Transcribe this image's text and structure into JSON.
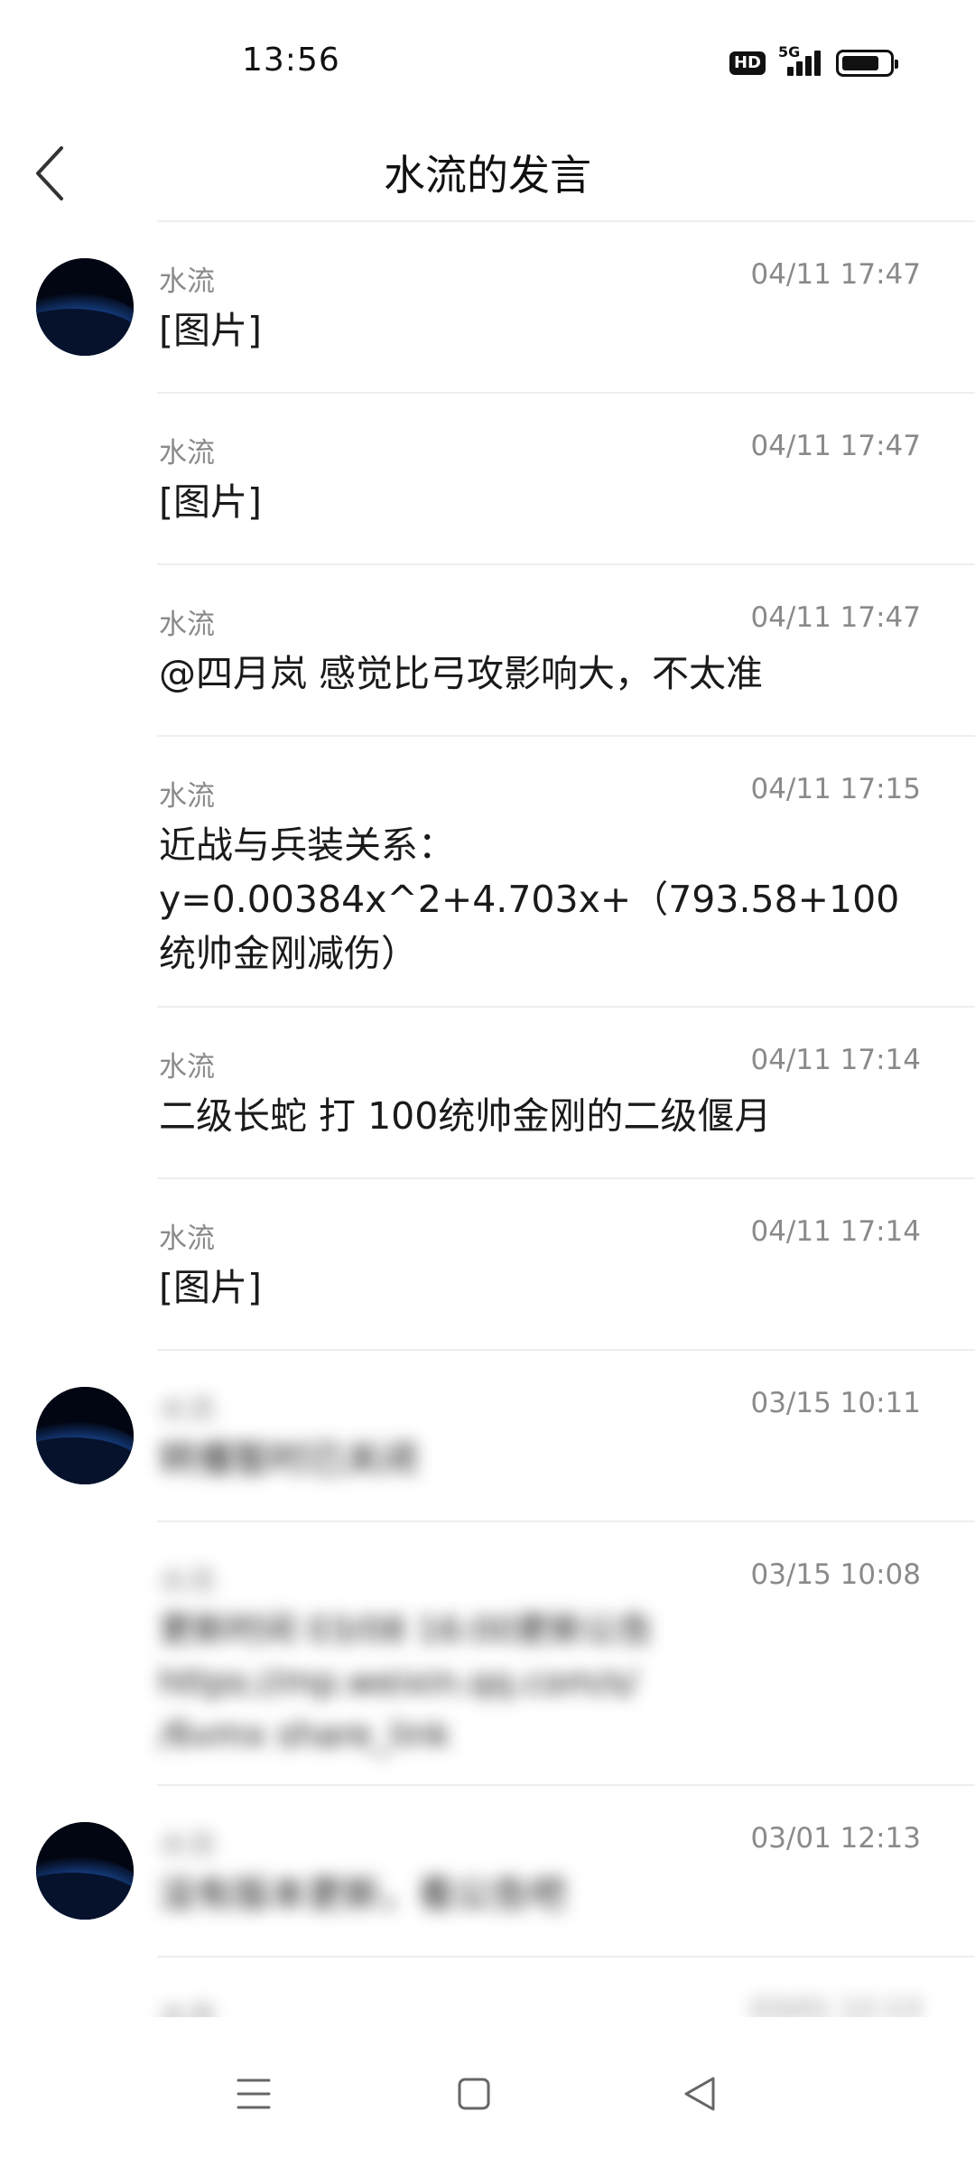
{
  "status_bar": {
    "time": "13:56",
    "hd_label": "HD",
    "network_label": "5G",
    "battery_level": 0.8
  },
  "header": {
    "title": "水流的发言",
    "back_icon": "chevron-left-icon"
  },
  "posts": [
    {
      "author": "水流",
      "time": "04/11 17:47",
      "content": "[图片]"
    },
    {
      "author": "水流",
      "time": "04/11 17:47",
      "content": "[图片]"
    },
    {
      "author": "水流",
      "time": "04/11 17:47",
      "content": "@四月岚 感觉比弓攻影响大，不太准"
    },
    {
      "author": "水流",
      "time": "04/11 17:15",
      "content": "近战与兵装关系：\ny=0.00384x^2+4.703x+（793.58+100统帅金刚减伤）"
    },
    {
      "author": "水流",
      "time": "04/11 17:14",
      "content": "二级长蛇 打 100统帅金刚的二级偃月"
    },
    {
      "author": "水流",
      "time": "04/11 17:14",
      "content": "[图片]"
    },
    {
      "author": "水流",
      "time": "03/15 10:11",
      "content": "转播暂时已关闭"
    },
    {
      "author": "水流",
      "time": "03/15 10:08",
      "content": "更新时间 03/08 16:00更新公告\nhttps://mp.weixin.qq.com/s/\n/6vmx share_link"
    },
    {
      "author": "水流",
      "time": "03/01 12:13",
      "content": "没有版本更新，看公告吧"
    },
    {
      "author": "水流",
      "time": "03/01 12:13",
      "content": ""
    }
  ],
  "nav_bar": {
    "menu_icon": "menu-icon",
    "home_icon": "home-square-icon",
    "back_icon": "back-triangle-icon"
  },
  "colors": {
    "background": "#ffffff",
    "meta_text": "#8a8a8a",
    "body_text": "#1a1a1a",
    "divider": "#eeeeee"
  }
}
